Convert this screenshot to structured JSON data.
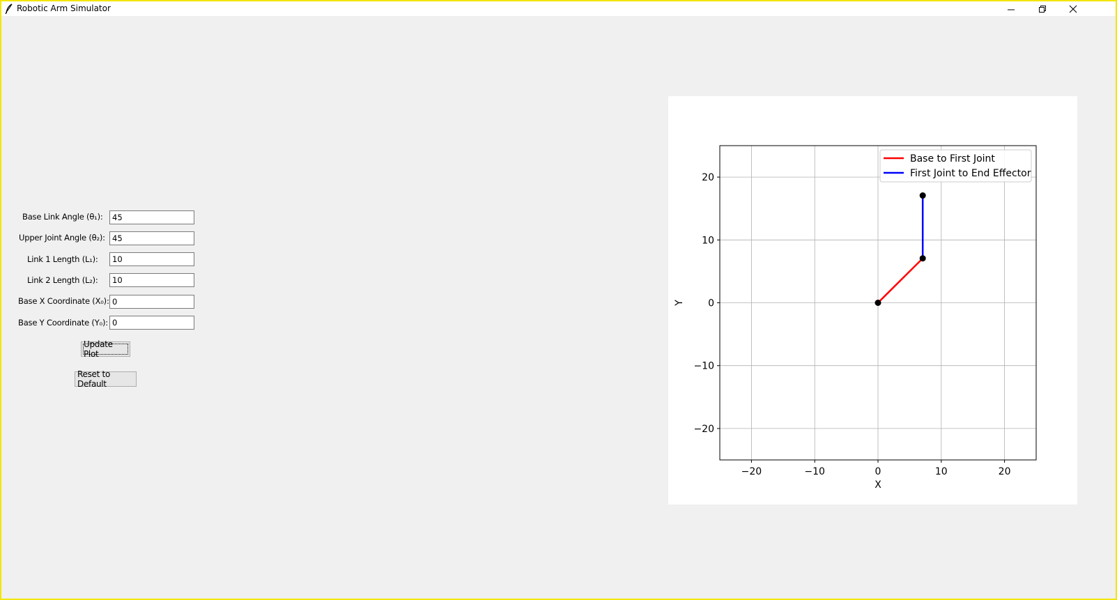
{
  "window": {
    "title": "Robotic Arm Simulator",
    "minimize_icon": "minimize-icon",
    "restore_icon": "restore-icon",
    "close_icon": "close-icon"
  },
  "form": {
    "fields": [
      {
        "label": "Base Link Angle (θ₁):",
        "value": "45"
      },
      {
        "label": "Upper Joint Angle (θ₂):",
        "value": "45"
      },
      {
        "label": "Link 1 Length (L₁):",
        "value": "10"
      },
      {
        "label": "Link 2 Length (L₂):",
        "value": "10"
      },
      {
        "label": "Base X Coordinate (X₀):",
        "value": "0"
      },
      {
        "label": "Base Y Coordinate (Y₀):",
        "value": "0"
      }
    ],
    "update_button": "Update Plot",
    "reset_button": "Reset to Default"
  },
  "chart_data": {
    "type": "line",
    "title": "",
    "xlabel": "X",
    "ylabel": "Y",
    "xlim": [
      -25,
      25
    ],
    "ylim": [
      -25,
      25
    ],
    "xticks": [
      -20,
      -10,
      0,
      10,
      20
    ],
    "yticks": [
      -20,
      -10,
      0,
      10,
      20
    ],
    "xtick_labels": [
      "−20",
      "−10",
      "0",
      "10",
      "20"
    ],
    "ytick_labels": [
      "−20",
      "−10",
      "0",
      "10",
      "20"
    ],
    "grid": true,
    "legend_position": "top-right",
    "series": [
      {
        "name": "Base to First Joint",
        "color": "#ff0000",
        "x": [
          0,
          7.07
        ],
        "y": [
          0,
          7.07
        ]
      },
      {
        "name": "First Joint to End Effector",
        "color": "#0000ff",
        "x": [
          7.07,
          7.07
        ],
        "y": [
          7.07,
          17.07
        ]
      }
    ],
    "joints": {
      "color": "#000000",
      "x": [
        0,
        7.07,
        7.07
      ],
      "y": [
        0,
        7.07,
        17.07
      ]
    }
  }
}
